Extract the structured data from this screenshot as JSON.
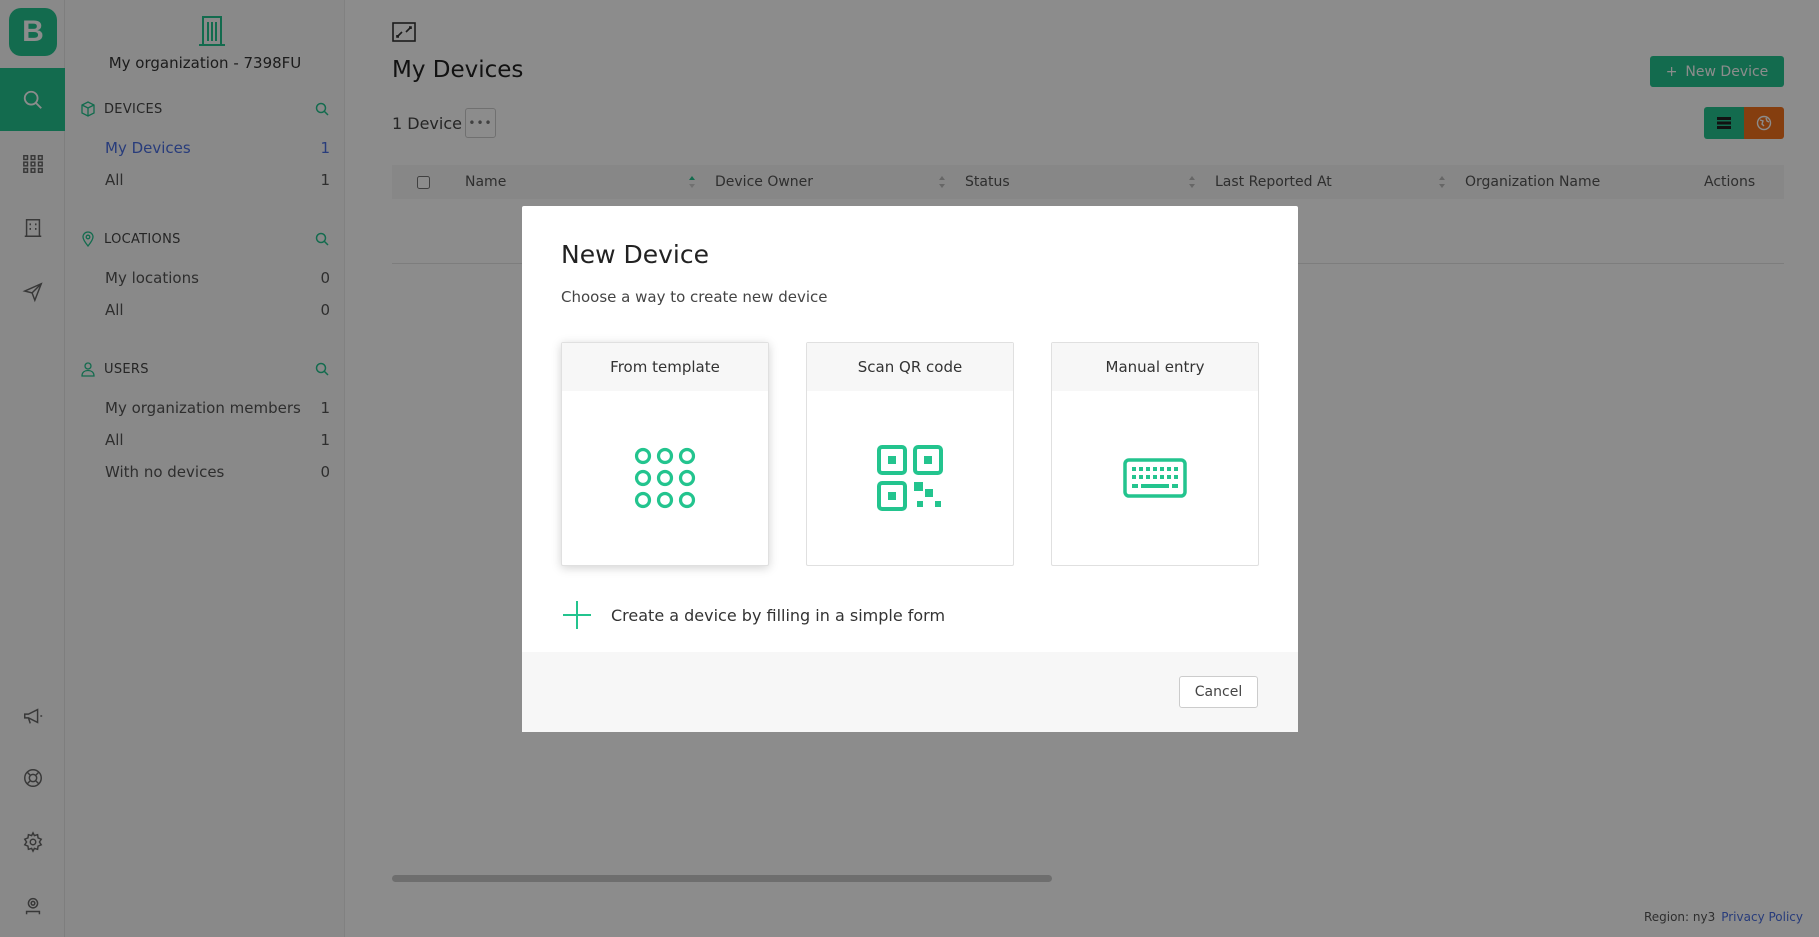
{
  "app": {
    "logo_letter": "B",
    "accent": "#23c48e",
    "secondary_accent": "#f2711c",
    "link_color": "#4a6ee0"
  },
  "rail": {
    "top_icons": [
      "search-icon",
      "apps-grid-icon",
      "building-icon",
      "send-icon"
    ],
    "bottom_icons": [
      "megaphone-icon",
      "lifebuoy-icon",
      "gear-icon",
      "user-badge-icon"
    ]
  },
  "sidebar": {
    "org_name": "My organization - 7398FU",
    "sections": [
      {
        "title": "DEVICES",
        "items": [
          {
            "label": "My Devices",
            "count": "1"
          },
          {
            "label": "All",
            "count": "1"
          }
        ]
      },
      {
        "title": "LOCATIONS",
        "items": [
          {
            "label": "My locations",
            "count": "0"
          },
          {
            "label": "All",
            "count": "0"
          }
        ]
      },
      {
        "title": "USERS",
        "items": [
          {
            "label": "My organization members",
            "count": "1"
          },
          {
            "label": "All",
            "count": "1"
          },
          {
            "label": "With no devices",
            "count": "0"
          }
        ]
      }
    ]
  },
  "main": {
    "title": "My Devices",
    "new_device_label": "New Device",
    "count_text": "1 Device",
    "columns": [
      "Name",
      "Device Owner",
      "Status",
      "Last Reported At",
      "Organization Name",
      "Actions"
    ]
  },
  "footer": {
    "region": "Region: ny3",
    "privacy": "Privacy Policy"
  },
  "modal": {
    "title": "New Device",
    "subtitle": "Choose a way to create new device",
    "cards": [
      {
        "label": "From template",
        "icon": "template-grid-icon"
      },
      {
        "label": "Scan QR code",
        "icon": "qr-code-icon"
      },
      {
        "label": "Manual entry",
        "icon": "keyboard-icon"
      }
    ],
    "form_link": "Create a device by filling in a simple form",
    "cancel": "Cancel"
  }
}
